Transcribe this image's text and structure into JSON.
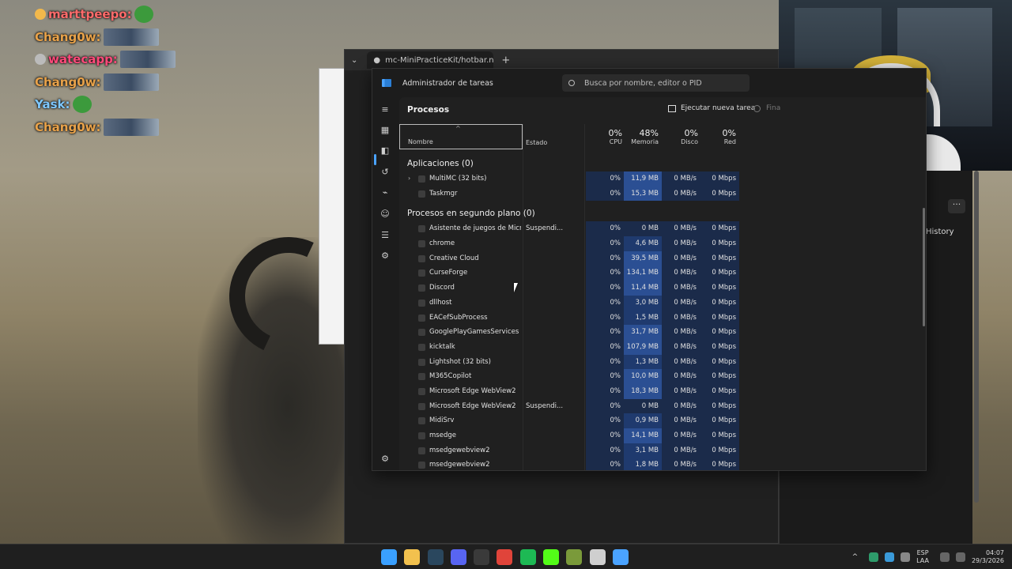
{
  "chat": [
    {
      "user": "marttpeepo:",
      "color": "#ff6b6b",
      "badge": "#f2b84b",
      "emote": "pepe"
    },
    {
      "user": "Chang0w:",
      "color": "#e8a24a",
      "badge": "",
      "emote": "face"
    },
    {
      "user": "watecapp:",
      "color": "#ff4a7a",
      "badge": "#bbbbbb",
      "emote": "face"
    },
    {
      "user": "Chang0w:",
      "color": "#e8a24a",
      "badge": "",
      "emote": "face"
    },
    {
      "user": "Yask:",
      "color": "#7fc8ff",
      "badge": "",
      "emote": "pepe"
    },
    {
      "user": "Chang0w:",
      "color": "#e8a24a",
      "badge": "",
      "emote": "face"
    }
  ],
  "browser": {
    "tab_title": "mc-MiniPracticeKit/hotbar.nbt",
    "history_label": "History"
  },
  "taskmgr": {
    "title": "Administrador de tareas",
    "search_placeholder": "Busca por nombre, editor o PID",
    "page_title": "Procesos",
    "new_task": "Ejecutar nueva tarea",
    "end_task": "Fina",
    "columns": {
      "name": "Nombre",
      "status": "Estado",
      "cpu_pct": "0%",
      "cpu": "CPU",
      "mem_pct": "48%",
      "mem": "Memoria",
      "disk_pct": "0%",
      "disk": "Disco",
      "net_pct": "0%",
      "net": "Red"
    },
    "apps_section": "Aplicaciones (0)",
    "apps": [
      {
        "name": "MultiMC (32 bits)",
        "status": "",
        "cpu": "0%",
        "mem": "11,9 MB",
        "disk": "0 MB/s",
        "net": "0 Mbps",
        "expand": true
      },
      {
        "name": "Taskmgr",
        "status": "",
        "cpu": "0%",
        "mem": "15,3 MB",
        "disk": "0 MB/s",
        "net": "0 Mbps",
        "expand": false
      }
    ],
    "bg_section": "Procesos en segundo plano (0)",
    "bg": [
      {
        "name": "Asistente de juegos de Micros...",
        "status": "Suspendi...",
        "cpu": "0%",
        "mem": "0 MB",
        "disk": "0 MB/s",
        "net": "0 Mbps"
      },
      {
        "name": "chrome",
        "status": "",
        "cpu": "0%",
        "mem": "4,6 MB",
        "disk": "0 MB/s",
        "net": "0 Mbps"
      },
      {
        "name": "Creative Cloud",
        "status": "",
        "cpu": "0%",
        "mem": "39,5 MB",
        "disk": "0 MB/s",
        "net": "0 Mbps"
      },
      {
        "name": "CurseForge",
        "status": "",
        "cpu": "0%",
        "mem": "134,1 MB",
        "disk": "0 MB/s",
        "net": "0 Mbps"
      },
      {
        "name": "Discord",
        "status": "",
        "cpu": "0%",
        "mem": "11,4 MB",
        "disk": "0 MB/s",
        "net": "0 Mbps"
      },
      {
        "name": "dllhost",
        "status": "",
        "cpu": "0%",
        "mem": "3,0 MB",
        "disk": "0 MB/s",
        "net": "0 Mbps"
      },
      {
        "name": "EACefSubProcess",
        "status": "",
        "cpu": "0%",
        "mem": "1,5 MB",
        "disk": "0 MB/s",
        "net": "0 Mbps"
      },
      {
        "name": "GooglePlayGamesServices",
        "status": "",
        "cpu": "0%",
        "mem": "31,7 MB",
        "disk": "0 MB/s",
        "net": "0 Mbps"
      },
      {
        "name": "kicktalk",
        "status": "",
        "cpu": "0%",
        "mem": "107,9 MB",
        "disk": "0 MB/s",
        "net": "0 Mbps"
      },
      {
        "name": "Lightshot (32 bits)",
        "status": "",
        "cpu": "0%",
        "mem": "1,3 MB",
        "disk": "0 MB/s",
        "net": "0 Mbps"
      },
      {
        "name": "M365Copilot",
        "status": "",
        "cpu": "0%",
        "mem": "10,0 MB",
        "disk": "0 MB/s",
        "net": "0 Mbps"
      },
      {
        "name": "Microsoft Edge WebView2",
        "status": "",
        "cpu": "0%",
        "mem": "18,3 MB",
        "disk": "0 MB/s",
        "net": "0 Mbps"
      },
      {
        "name": "Microsoft Edge WebView2",
        "status": "Suspendi...",
        "cpu": "0%",
        "mem": "0 MB",
        "disk": "0 MB/s",
        "net": "0 Mbps"
      },
      {
        "name": "MidiSrv",
        "status": "",
        "cpu": "0%",
        "mem": "0,9 MB",
        "disk": "0 MB/s",
        "net": "0 Mbps"
      },
      {
        "name": "msedge",
        "status": "",
        "cpu": "0%",
        "mem": "14,1 MB",
        "disk": "0 MB/s",
        "net": "0 Mbps"
      },
      {
        "name": "msedgewebview2",
        "status": "",
        "cpu": "0%",
        "mem": "3,1 MB",
        "disk": "0 MB/s",
        "net": "0 Mbps"
      },
      {
        "name": "msedgewebview2",
        "status": "",
        "cpu": "0%",
        "mem": "1,8 MB",
        "disk": "0 MB/s",
        "net": "0 Mbps"
      }
    ]
  },
  "taskbar": {
    "lang_top": "ESP",
    "lang_bottom": "LAA",
    "time": "04:07",
    "date": "29/3/2026",
    "icons": [
      {
        "name": "windows-start-icon",
        "color": "#3aa0ff"
      },
      {
        "name": "file-explorer-icon",
        "color": "#f2c14e"
      },
      {
        "name": "steam-icon",
        "color": "#2a475e"
      },
      {
        "name": "discord-icon",
        "color": "#5865f2"
      },
      {
        "name": "obs-icon",
        "color": "#3a3a3a"
      },
      {
        "name": "chrome-icon",
        "color": "#e0443a"
      },
      {
        "name": "spotify-icon",
        "color": "#1db954"
      },
      {
        "name": "kick-icon",
        "color": "#53fc18"
      },
      {
        "name": "minecraft-icon",
        "color": "#7a9a3a"
      },
      {
        "name": "curseforge-icon",
        "color": "#cfcfcf"
      },
      {
        "name": "taskmgr-icon",
        "color": "#4aa3ff"
      }
    ]
  }
}
